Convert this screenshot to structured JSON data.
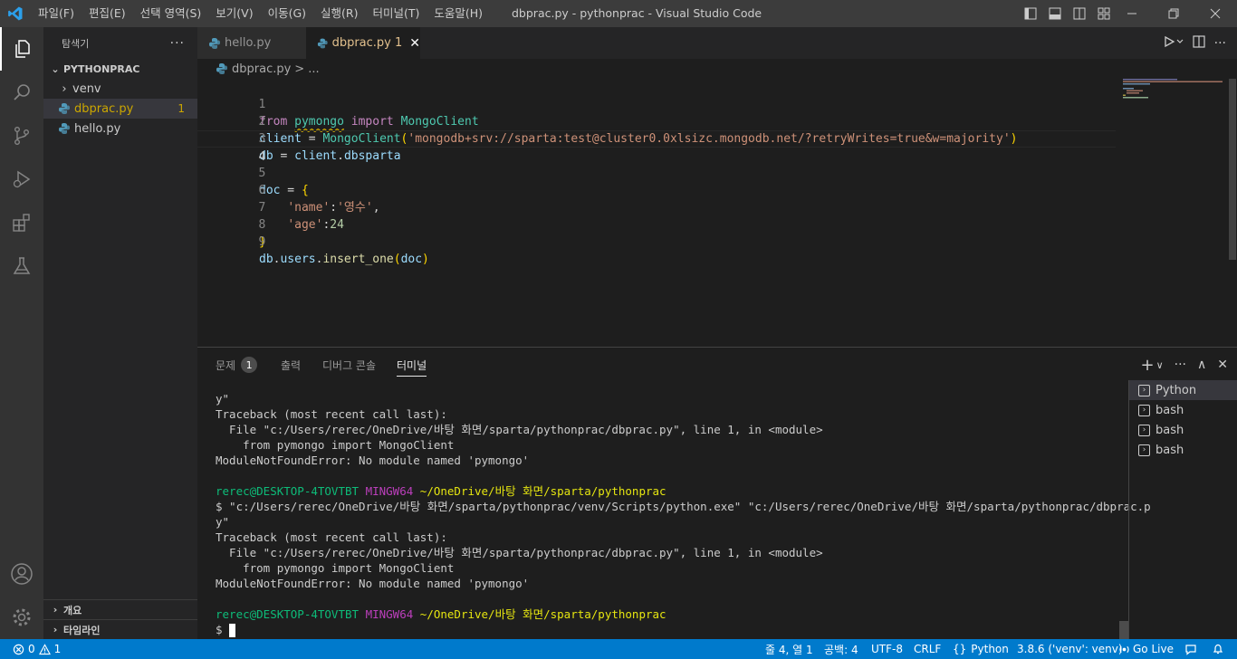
{
  "window": {
    "title": "dbprac.py - pythonprac - Visual Studio Code",
    "menu": [
      "파일(F)",
      "편집(E)",
      "선택 영역(S)",
      "보기(V)",
      "이동(G)",
      "실행(R)",
      "터미널(T)",
      "도움말(H)"
    ]
  },
  "sidebar": {
    "title": "탐색기",
    "more": "···",
    "folder": "PYTHONPRAC",
    "items": [
      {
        "label": "venv",
        "type": "folder"
      },
      {
        "label": "dbprac.py",
        "badge": "1",
        "type": "file"
      },
      {
        "label": "hello.py",
        "type": "file"
      }
    ],
    "outline": "개요",
    "timeline": "타임라인"
  },
  "tabs": [
    {
      "label": "hello.py"
    },
    {
      "label": "dbprac.py 1",
      "close": "✕"
    }
  ],
  "breadcrumb": {
    "file": "dbprac.py",
    "sep": ">",
    "rest": "..."
  },
  "editor": {
    "line_numbers": [
      "1",
      "2",
      "3",
      "4",
      "5",
      "6",
      "7",
      "8",
      "9"
    ],
    "lines": {
      "l1": {
        "t0": "from",
        "t1": " ",
        "t2": "pymongo",
        "t3": " ",
        "t4": "import",
        "t5": " ",
        "t6": "MongoClient"
      },
      "l2": {
        "t0": "client",
        "t1": " = ",
        "t2": "MongoClient",
        "t3": "(",
        "t4": "'mongodb+srv://sparta:test@cluster0.0xlsizc.mongodb.net/?retryWrites=true&w=majority'",
        "t5": ")"
      },
      "l3": {
        "t0": "db",
        "t1": " = ",
        "t2": "client",
        "t3": ".",
        "t4": "dbsparta"
      },
      "l5": {
        "t0": "doc",
        "t1": " = ",
        "t2": "{"
      },
      "l6": {
        "t0": "    ",
        "t1": "'name'",
        "t2": ":",
        "t3": "'영수'",
        "t4": ","
      },
      "l7": {
        "t0": "    ",
        "t1": "'age'",
        "t2": ":",
        "t3": "24"
      },
      "l8": {
        "t0": "}"
      },
      "l9": {
        "t0": "db",
        "t1": ".",
        "t2": "users",
        "t3": ".",
        "t4": "insert_one",
        "t5": "(",
        "t6": "doc",
        "t7": ")"
      }
    }
  },
  "panel": {
    "tabs": [
      {
        "label": "문제",
        "badge": "1"
      },
      {
        "label": "출력"
      },
      {
        "label": "디버그 콘솔"
      },
      {
        "label": "터미널"
      }
    ],
    "actions": {
      "add": "+",
      "dropdown": "∨",
      "more": "···",
      "maximize": "∧",
      "close": "✕"
    },
    "terminal_lines": [
      {
        "text": "y\""
      },
      {
        "text": "Traceback (most recent call last):"
      },
      {
        "text": "  File \"c:/Users/rerec/OneDrive/바탕 화면/sparta/pythonprac/dbprac.py\", line 1, in <module>"
      },
      {
        "text": "    from pymongo import MongoClient"
      },
      {
        "text": "ModuleNotFoundError: No module named 'pymongo'"
      },
      {
        "text": ""
      },
      {
        "user": "rerec@DESKTOP-4TOVTBT",
        "host": " MINGW64",
        "path": " ~/OneDrive/바탕 화면/sparta/pythonprac"
      },
      {
        "text": "$ \"c:/Users/rerec/OneDrive/바탕 화면/sparta/pythonprac/venv/Scripts/python.exe\" \"c:/Users/rerec/OneDrive/바탕 화면/sparta/pythonprac/dbprac.p"
      },
      {
        "text": "y\""
      },
      {
        "text": "Traceback (most recent call last):"
      },
      {
        "text": "  File \"c:/Users/rerec/OneDrive/바탕 화면/sparta/pythonprac/dbprac.py\", line 1, in <module>"
      },
      {
        "text": "    from pymongo import MongoClient"
      },
      {
        "text": "ModuleNotFoundError: No module named 'pymongo'"
      },
      {
        "text": ""
      },
      {
        "user": "rerec@DESKTOP-4TOVTBT",
        "host": " MINGW64",
        "path": " ~/OneDrive/바탕 화면/sparta/pythonprac"
      },
      {
        "prompt": "$ "
      }
    ],
    "terminal_list": [
      "Python",
      "bash",
      "bash",
      "bash"
    ]
  },
  "statusbar": {
    "errors": "0",
    "warnings": "1",
    "position": "줄 4, 열 1",
    "spaces": "공백: 4",
    "encoding": "UTF-8",
    "eol": "CRLF",
    "language": "Python",
    "interpreter": "3.8.6 ('venv': venv)",
    "golive": "Go Live"
  },
  "colors": {
    "statusbar": "#007acc",
    "activitybar": "#333333",
    "editor_bg": "#1e1e1e",
    "warning": "#cca700"
  },
  "icons": [
    "vscode-logo-icon",
    "explorer-icon",
    "search-icon",
    "source-control-icon",
    "run-debug-icon",
    "extensions-icon",
    "testing-icon",
    "account-icon",
    "manage-gear-icon",
    "python-file-icon",
    "run-icon",
    "split-editor-icon",
    "error-icon",
    "warning-icon",
    "golive-icon",
    "feedback-icon",
    "bell-icon"
  ]
}
